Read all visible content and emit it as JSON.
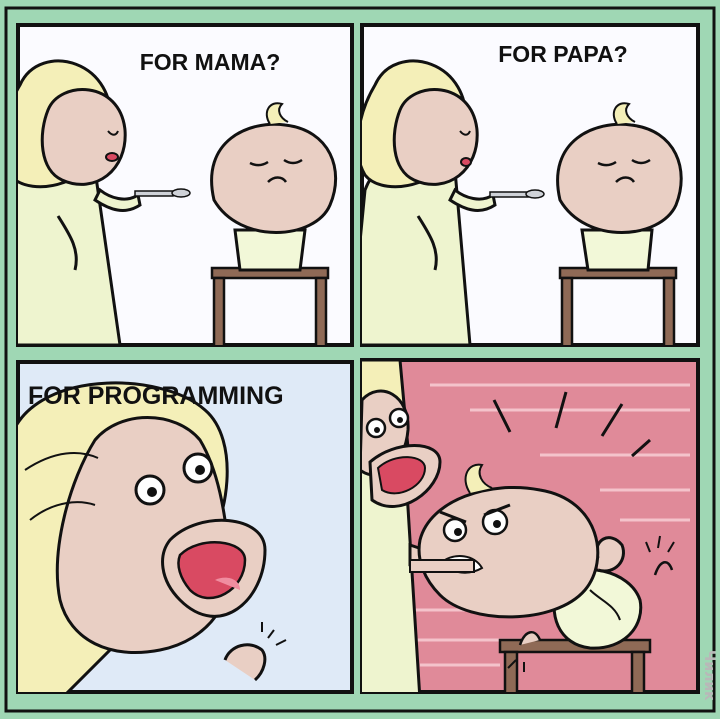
{
  "comic": {
    "panels": [
      {
        "caption": "FOR MAMA?"
      },
      {
        "caption": "FOR PAPA?"
      },
      {
        "caption": "FOR PROGRAMMING"
      },
      {
        "caption": ""
      }
    ],
    "watermark": "Чилик"
  },
  "colors": {
    "background": "#9fd7b4",
    "panel_bg": "#ffffff",
    "skin": "#e9cfc4",
    "hair": "#f4efb8",
    "dress": "#eef4cf",
    "bib": "#f2f8d8",
    "chair": "#8f6a56",
    "angry_bg": "#e08a99",
    "outline": "#111111"
  }
}
